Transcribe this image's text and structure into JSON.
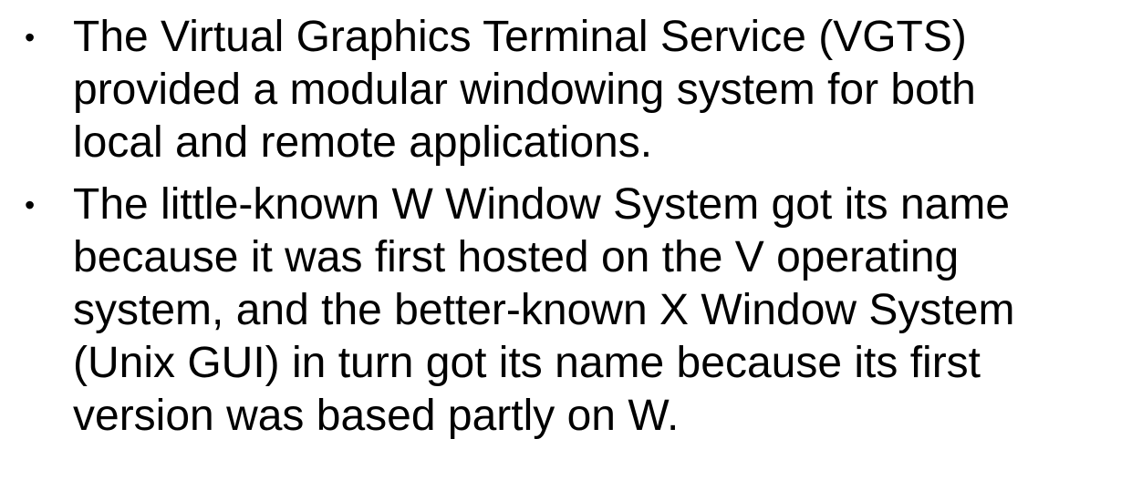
{
  "slide": {
    "bullet_symbol": "•",
    "bullets": [
      {
        "lines": [
          "The Virtual Graphics Terminal Service (VGTS)",
          "provided a modular windowing system for both",
          "local and remote applications."
        ]
      },
      {
        "lines": [
          "The little-known W Window System got its name",
          "because it was first hosted on the V operating",
          "system, and the better-known X Window System",
          "(Unix GUI) in turn got its name because its first",
          "version was based partly on W."
        ]
      }
    ]
  }
}
